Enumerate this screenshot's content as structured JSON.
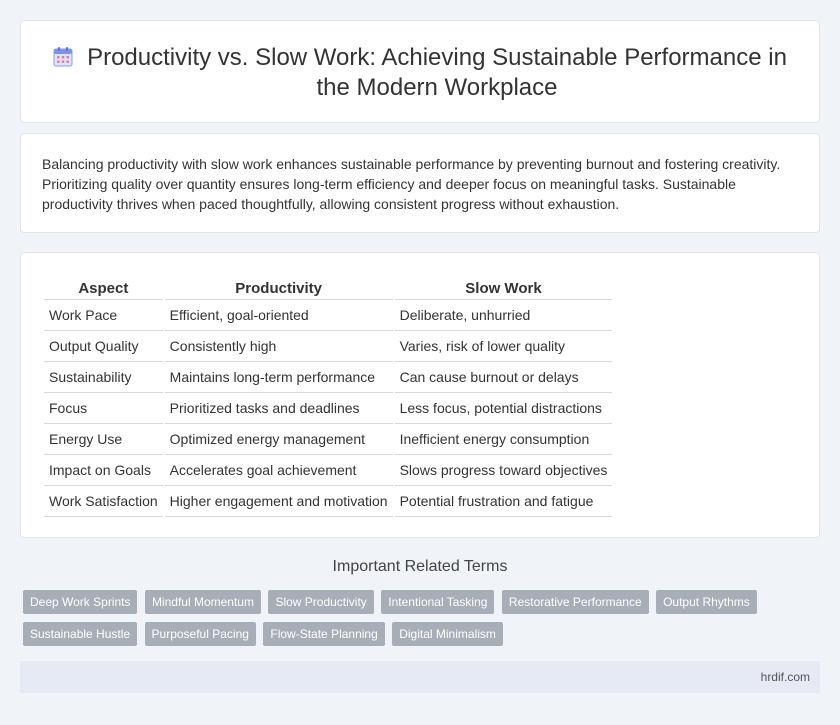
{
  "header": {
    "title": "Productivity vs. Slow Work: Achieving Sustainable Performance in the Modern Workplace",
    "icon": "calendar-icon"
  },
  "summary": {
    "text": "Balancing productivity with slow work enhances sustainable performance by preventing burnout and fostering creativity. Prioritizing quality over quantity ensures long-term efficiency and deeper focus on meaningful tasks. Sustainable productivity thrives when paced thoughtfully, allowing consistent progress without exhaustion."
  },
  "comparison": {
    "headers": [
      "Aspect",
      "Productivity",
      "Slow Work"
    ],
    "rows": [
      [
        "Work Pace",
        "Efficient, goal-oriented",
        "Deliberate, unhurried"
      ],
      [
        "Output Quality",
        "Consistently high",
        "Varies, risk of lower quality"
      ],
      [
        "Sustainability",
        "Maintains long-term performance",
        "Can cause burnout or delays"
      ],
      [
        "Focus",
        "Prioritized tasks and deadlines",
        "Less focus, potential distractions"
      ],
      [
        "Energy Use",
        "Optimized energy management",
        "Inefficient energy consumption"
      ],
      [
        "Impact on Goals",
        "Accelerates goal achievement",
        "Slows progress toward objectives"
      ],
      [
        "Work Satisfaction",
        "Higher engagement and motivation",
        "Potential frustration and fatigue"
      ]
    ]
  },
  "related": {
    "title": "Important Related Terms",
    "tags": [
      "Deep Work Sprints",
      "Mindful Momentum",
      "Slow Productivity",
      "Intentional Tasking",
      "Restorative Performance",
      "Output Rhythms",
      "Sustainable Hustle",
      "Purposeful Pacing",
      "Flow-State Planning",
      "Digital Minimalism"
    ]
  },
  "footer": {
    "site": "hrdif.com"
  },
  "colors": {
    "tag_bg": "#a8aeb7",
    "page_bg": "#f0f3f8",
    "footer_bg": "#e5eaf4"
  }
}
